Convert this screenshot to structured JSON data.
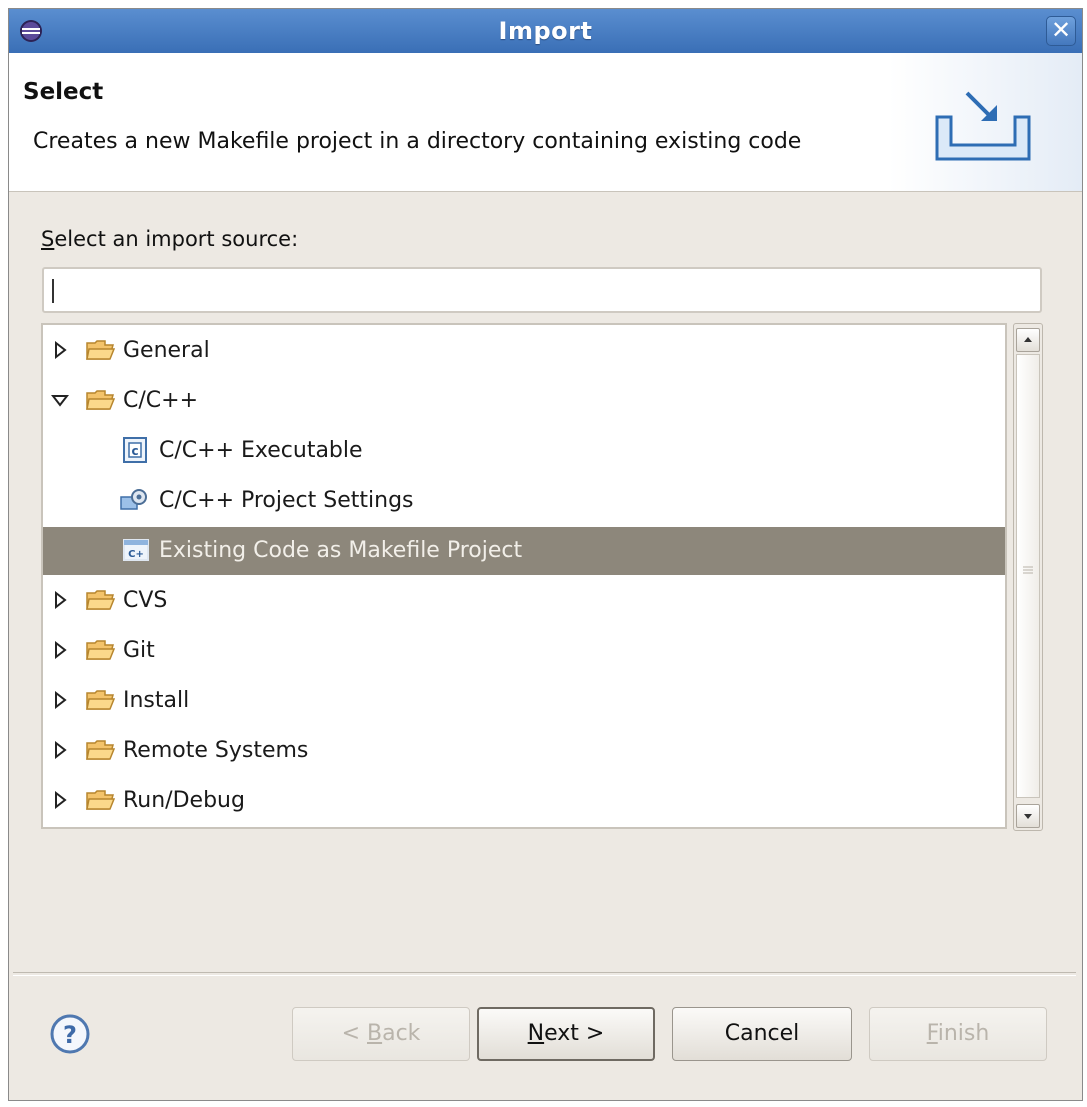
{
  "window": {
    "title": "Import",
    "close_glyph": "✕"
  },
  "header": {
    "title": "Select",
    "description": "Creates a new Makefile project in a directory containing existing code"
  },
  "source": {
    "label_mnemonic": "S",
    "label_rest": "elect an import source:",
    "filter_value": ""
  },
  "tree": {
    "items": [
      {
        "label": "General",
        "expanded": false,
        "icon": "folder-icon"
      },
      {
        "label": "C/C++",
        "expanded": true,
        "icon": "folder-icon"
      },
      {
        "label": "C/C++ Executable",
        "icon": "c-executable-icon"
      },
      {
        "label": "C/C++ Project Settings",
        "icon": "project-settings-icon"
      },
      {
        "label": "Existing Code as Makefile Project",
        "icon": "makefile-project-icon",
        "selected": true
      },
      {
        "label": "CVS",
        "expanded": false,
        "icon": "folder-icon"
      },
      {
        "label": "Git",
        "expanded": false,
        "icon": "folder-icon"
      },
      {
        "label": "Install",
        "expanded": false,
        "icon": "folder-icon"
      },
      {
        "label": "Remote Systems",
        "expanded": false,
        "icon": "folder-icon"
      },
      {
        "label": "Run/Debug",
        "expanded": false,
        "icon": "folder-icon"
      }
    ]
  },
  "buttons": {
    "back_prefix": "< ",
    "back_mnemonic": "B",
    "back_rest": "ack",
    "next_mnemonic": "N",
    "next_rest": "ext >",
    "cancel": "Cancel",
    "finish_mnemonic": "F",
    "finish_rest": "inish"
  },
  "colors": {
    "titlebar": "#3a6fb6",
    "selection": "#8d877b",
    "dialog_bg": "#ede9e3"
  }
}
